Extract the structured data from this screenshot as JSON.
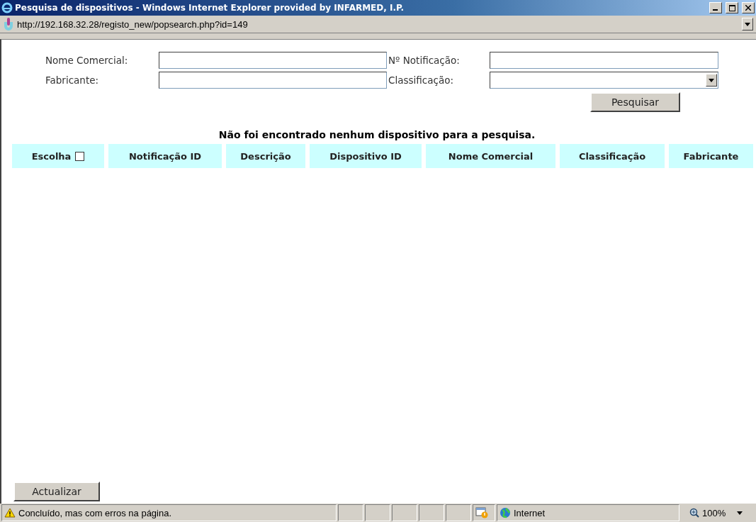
{
  "window": {
    "title": "Pesquisa de dispositivos - Windows Internet Explorer provided by INFARMED, I.P."
  },
  "address_bar": {
    "url": "http://192.168.32.28/registo_new/popsearch.php?id=149"
  },
  "form": {
    "fields": [
      {
        "label": "Nome Comercial:",
        "kind": "text"
      },
      {
        "label": "Nº Notificação:",
        "kind": "text"
      },
      {
        "label": "Fabricante:",
        "kind": "text"
      },
      {
        "label": "Classificação:",
        "kind": "select"
      }
    ],
    "search_button": "Pesquisar"
  },
  "message": "Não foi encontrado nenhum dispositivo para a pesquisa.",
  "table": {
    "columns": [
      {
        "label": "Escolha",
        "kind": "checkbox",
        "checked": false
      },
      {
        "label": "Notificação ID",
        "kind": "text"
      },
      {
        "label": "Descrição",
        "kind": "text"
      },
      {
        "label": "Dispositivo ID",
        "kind": "text"
      },
      {
        "label": "Nome Comercial",
        "kind": "text"
      },
      {
        "label": "Classificação",
        "kind": "text"
      },
      {
        "label": "Fabricante",
        "kind": "text"
      }
    ]
  },
  "refresh_button": "Actualizar",
  "status_bar": {
    "text": "Concluído, mas com erros na página.",
    "zone": "Internet",
    "zoom": "100%"
  }
}
